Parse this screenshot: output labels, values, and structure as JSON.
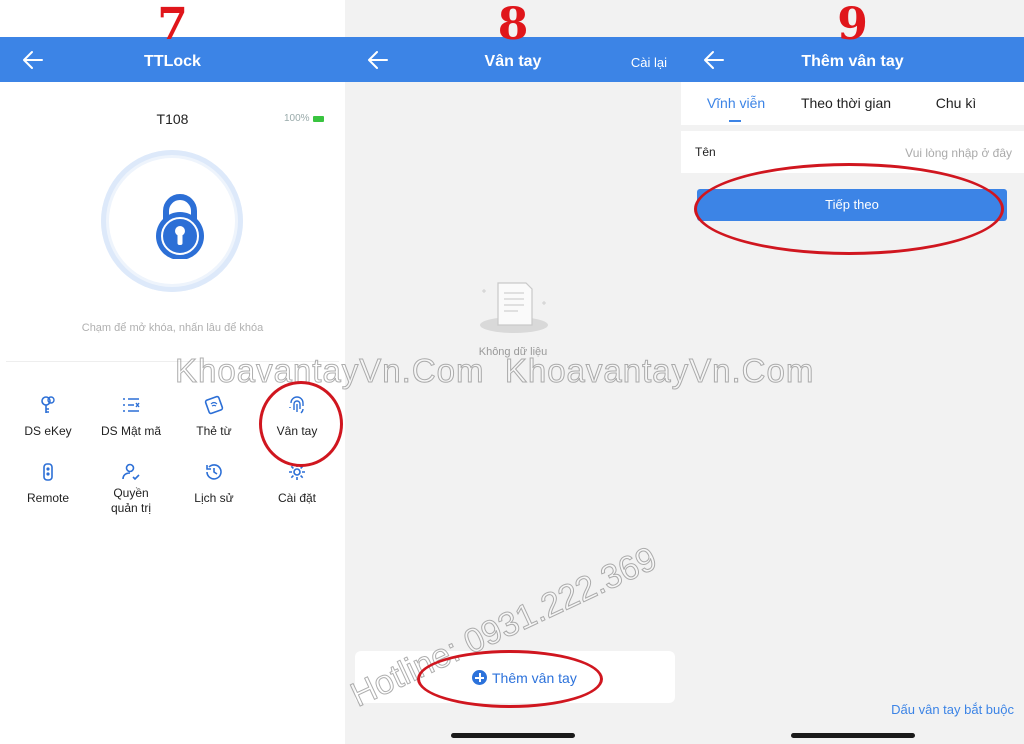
{
  "steps": {
    "p7": "7",
    "p8": "8",
    "p9": "9"
  },
  "screen7": {
    "title": "TTLock",
    "lock_name": "T108",
    "battery": "100%",
    "hint": "Chạm để mở khóa, nhấn lâu để khóa",
    "menu": [
      {
        "label": "DS eKey",
        "icon": "key-icon"
      },
      {
        "label": "DS Mật mã",
        "icon": "passcode-list-icon"
      },
      {
        "label": "Thẻ từ",
        "icon": "card-icon"
      },
      {
        "label": "Vân tay",
        "icon": "fingerprint-icon"
      },
      {
        "label": "Remote",
        "icon": "remote-icon"
      },
      {
        "label": "Quyền\nquản trị",
        "icon": "admin-icon"
      },
      {
        "label": "Lịch sử",
        "icon": "history-icon"
      },
      {
        "label": "Cài đặt",
        "icon": "settings-icon"
      }
    ]
  },
  "screen8": {
    "title": "Vân tay",
    "reset": "Cài lại",
    "empty": "Không dữ liệu",
    "add_button": "Thêm vân tay"
  },
  "screen9": {
    "title": "Thêm vân tay",
    "tabs": [
      "Vĩnh viễn",
      "Theo thời gian",
      "Chu kì"
    ],
    "name_label": "Tên",
    "name_placeholder": "Vui lòng nhập ở đây",
    "name_value": "",
    "next_button": "Tiếp theo",
    "footer_link": "Dấu vân tay bắt buộc"
  },
  "watermark": "KhoavantayVn.Com  KhoavantayVn.Com",
  "hotline": "Hotline: 0931.222.369",
  "colors": {
    "brand_blue": "#3c84e6",
    "annotation_red": "#d0161f",
    "battery_green": "#39c440"
  }
}
